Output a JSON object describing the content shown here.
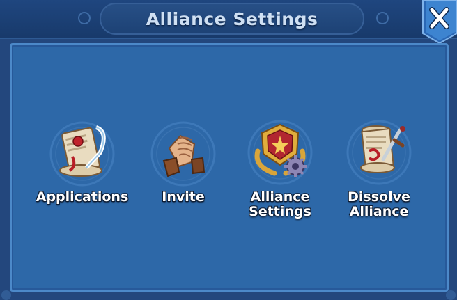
{
  "window": {
    "title": "Alliance Settings"
  },
  "close_icon": "close-icon",
  "options": [
    {
      "label": "Applications",
      "icon": "scroll-quill-icon"
    },
    {
      "label": "Invite",
      "icon": "handshake-icon"
    },
    {
      "label": "Alliance\nSettings",
      "icon": "crest-gear-icon"
    },
    {
      "label": "Dissolve\nAlliance",
      "icon": "scroll-dagger-icon"
    }
  ],
  "colors": {
    "panel": "#2d68a8",
    "header": "#1f467f",
    "title_text": "#cfe0f3",
    "close_button": "#3f86d3"
  }
}
